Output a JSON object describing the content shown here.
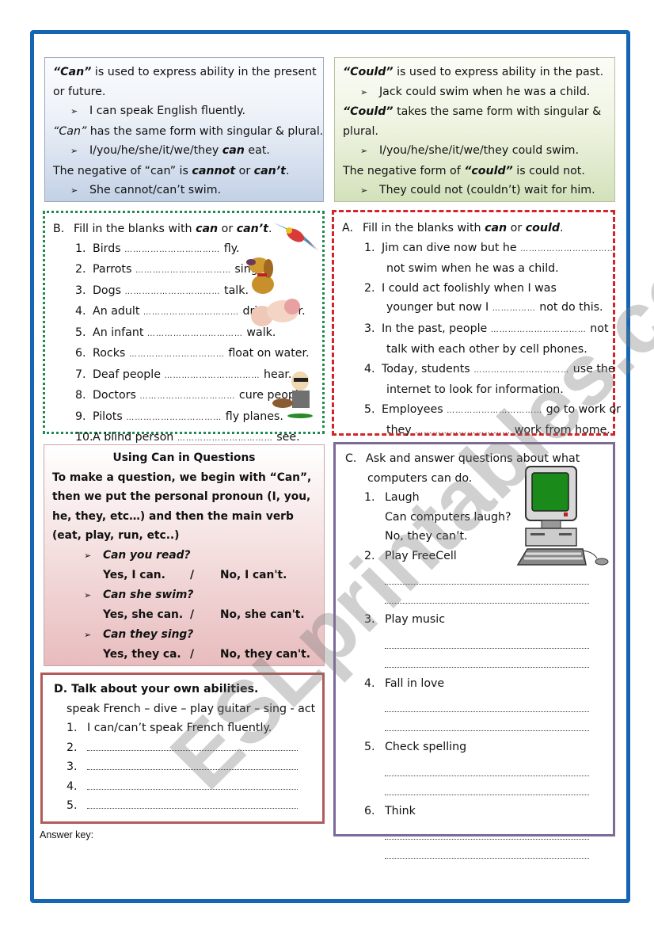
{
  "can_box": {
    "lines": [
      {
        "bold": "“Can”",
        "text": " is used to express ability in the present"
      },
      {
        "text": "or future."
      },
      {
        "arrow": "➢",
        "text": "I can speak English fluently."
      },
      {
        "bold": "“Can”",
        "text": " has the same form with singular & plural."
      },
      {
        "arrow": "➢",
        "text": "I/you/he/she/it/we/they ",
        "bold_end": "can",
        "text2": " eat."
      },
      {
        "text": "The negative of “can” is ",
        "bold_end": "cannot",
        "text2": " or ",
        "bold_end2": "can’t",
        "text3": "."
      },
      {
        "arrow": "➢",
        "text": "She cannot/can’t swim."
      }
    ]
  },
  "could_box": {
    "lines": [
      {
        "bold": "“Could”",
        "text": " is used to express ability in the past."
      },
      {
        "arrow": "➢",
        "text": "Jack could swim when he was a child."
      },
      {
        "bold": "“Could”",
        "text": " takes the same form with singular &"
      },
      {
        "text": "plural."
      },
      {
        "arrow": "➢",
        "text": "I/you/he/she/it/we/they could swim."
      },
      {
        "text": "The negative form of ",
        "bold_end": "“could”",
        "text2": " is could not."
      },
      {
        "arrow": "➢",
        "text": "They could not (couldn’t) wait for him."
      }
    ]
  },
  "exercise_b": {
    "letter": "B.",
    "instruction": "Fill in the blanks with ",
    "word1": "can",
    "or": " or ",
    "word2": "can’t",
    "period": ".",
    "items": [
      {
        "n": "1.",
        "before": "Birds",
        "after": "fly."
      },
      {
        "n": "2.",
        "before": "Parrots",
        "after": "sing."
      },
      {
        "n": "3.",
        "before": "Dogs",
        "after": "talk."
      },
      {
        "n": "4.",
        "before": "An adult",
        "after": "drive a car."
      },
      {
        "n": "5.",
        "before": "An infant",
        "after": "walk."
      },
      {
        "n": "6.",
        "before": "Rocks",
        "after": "float on water."
      },
      {
        "n": "7.",
        "before": "Deaf people",
        "after": "hear."
      },
      {
        "n": "8.",
        "before": "Doctors",
        "after": "cure people."
      },
      {
        "n": "9.",
        "before": "Pilots",
        "after": "fly planes."
      },
      {
        "n": "10.",
        "before": "A blind person",
        "after": "see."
      }
    ],
    "blank": "……………………………"
  },
  "exercise_a": {
    "letter": "A.",
    "instruction": "Fill in the blanks with ",
    "word1": "can",
    "or": " or ",
    "word2": "could",
    "period": ".",
    "items": [
      {
        "n": "1.",
        "line1": "Jim can dive now but he ",
        "blank1": true,
        "line2": "not swim when he was a child."
      },
      {
        "n": "2.",
        "line1": "I could act foolishly when I was",
        "line2a": "younger but now I ",
        "blank2": true,
        "line2b": " not do this."
      },
      {
        "n": "3.",
        "line1": "In the past, people ",
        "blank1": true,
        "line1b": " not",
        "line2": "talk with each other by cell phones."
      },
      {
        "n": "4.",
        "line1": "Today, students ",
        "blank1": true,
        "line1b": " use the",
        "line2": "internet to look for information."
      },
      {
        "n": "5.",
        "line1": "Employees ",
        "blank1": true,
        "line1b": " go to work or",
        "line2a": "they ",
        "blank2": true,
        "line2b": " work from home."
      }
    ],
    "blank": "……………………………",
    "short_blank": "……………"
  },
  "questions_box": {
    "title": "Using Can in Questions",
    "body": [
      "To make a question, we begin with “Can”,",
      "then we put the personal pronoun (I, you,",
      "he, they, etc…) and then the main verb",
      "(eat, play, run, etc..)"
    ],
    "examples": [
      {
        "q": "Can you read?",
        "yes": "Yes, I can.",
        "no": "No, I can't."
      },
      {
        "q": "Can she swim?",
        "yes": "Yes, she can.",
        "no": "No, she can't."
      },
      {
        "q": "Can they sing?",
        "yes": "Yes, they ca.",
        "no": "No, they can't."
      }
    ],
    "separator": "/",
    "arrow": "➢"
  },
  "exercise_d": {
    "title": "D. Talk about your own abilities.",
    "words": "speak French – dive – play guitar – sing - act",
    "items": [
      {
        "n": "1.",
        "text": "I can/can’t speak French fluently."
      },
      {
        "n": "2.",
        "text": ""
      },
      {
        "n": "3.",
        "text": ""
      },
      {
        "n": "4.",
        "text": ""
      },
      {
        "n": "5.",
        "text": ""
      }
    ]
  },
  "exercise_c": {
    "letter": "C.",
    "instruction_line1": "Ask and answer questions about what",
    "instruction_line2": "computers can do.",
    "items": [
      {
        "n": "1.",
        "label": "Laugh",
        "example_q": "Can computers laugh?",
        "example_a": "No, they can’t."
      },
      {
        "n": "2.",
        "label": "Play FreeCell"
      },
      {
        "n": "3.",
        "label": "Play music"
      },
      {
        "n": "4.",
        "label": "Fall in love"
      },
      {
        "n": "5.",
        "label": "Check spelling"
      },
      {
        "n": "6.",
        "label": "Think"
      }
    ]
  },
  "answer_key_label": "Answer key:",
  "watermark": "ESLprintables.com",
  "colors": {
    "frame": "#1466b4",
    "exercise_b_border": "#1e8a52",
    "exercise_a_border": "#d3242b",
    "exercise_c_border": "#7b6a9a",
    "exercise_d_border": "#b25b5b",
    "monitor_screen": "#1a8a1a"
  }
}
